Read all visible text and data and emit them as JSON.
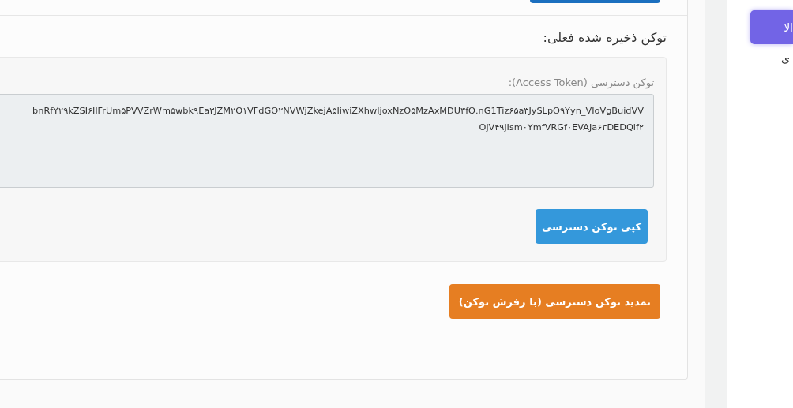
{
  "section": {
    "heading": "توکن ذخیره شده فعلی:",
    "token_field": {
      "label": "توکن دسترسی (Access Token):",
      "value_lines": [
        "bnRfY۲۹kZSI۶IlFrUm۵PVVZrWm۵wbk۹Ea۳JZM۲Q۱VFdGQ۲NVWjZkejA۵IiwiZXhwIjoxNzQ۵MzAxMDU۳fQ.nG1Tiz۶۵a۳JySLpO۹Yyn_VIoVgBuidVV",
        "OjV۴۹jIsm۰YmfVRGf۰EVAJa۶۳DEDQif۲"
      ]
    },
    "copy_button": "کپی توکن دسترسی",
    "refresh_button": "تمدید توکن دسترسی (با رفرش توکن)"
  },
  "sidebar": {
    "button": "الا",
    "item": "ی"
  }
}
